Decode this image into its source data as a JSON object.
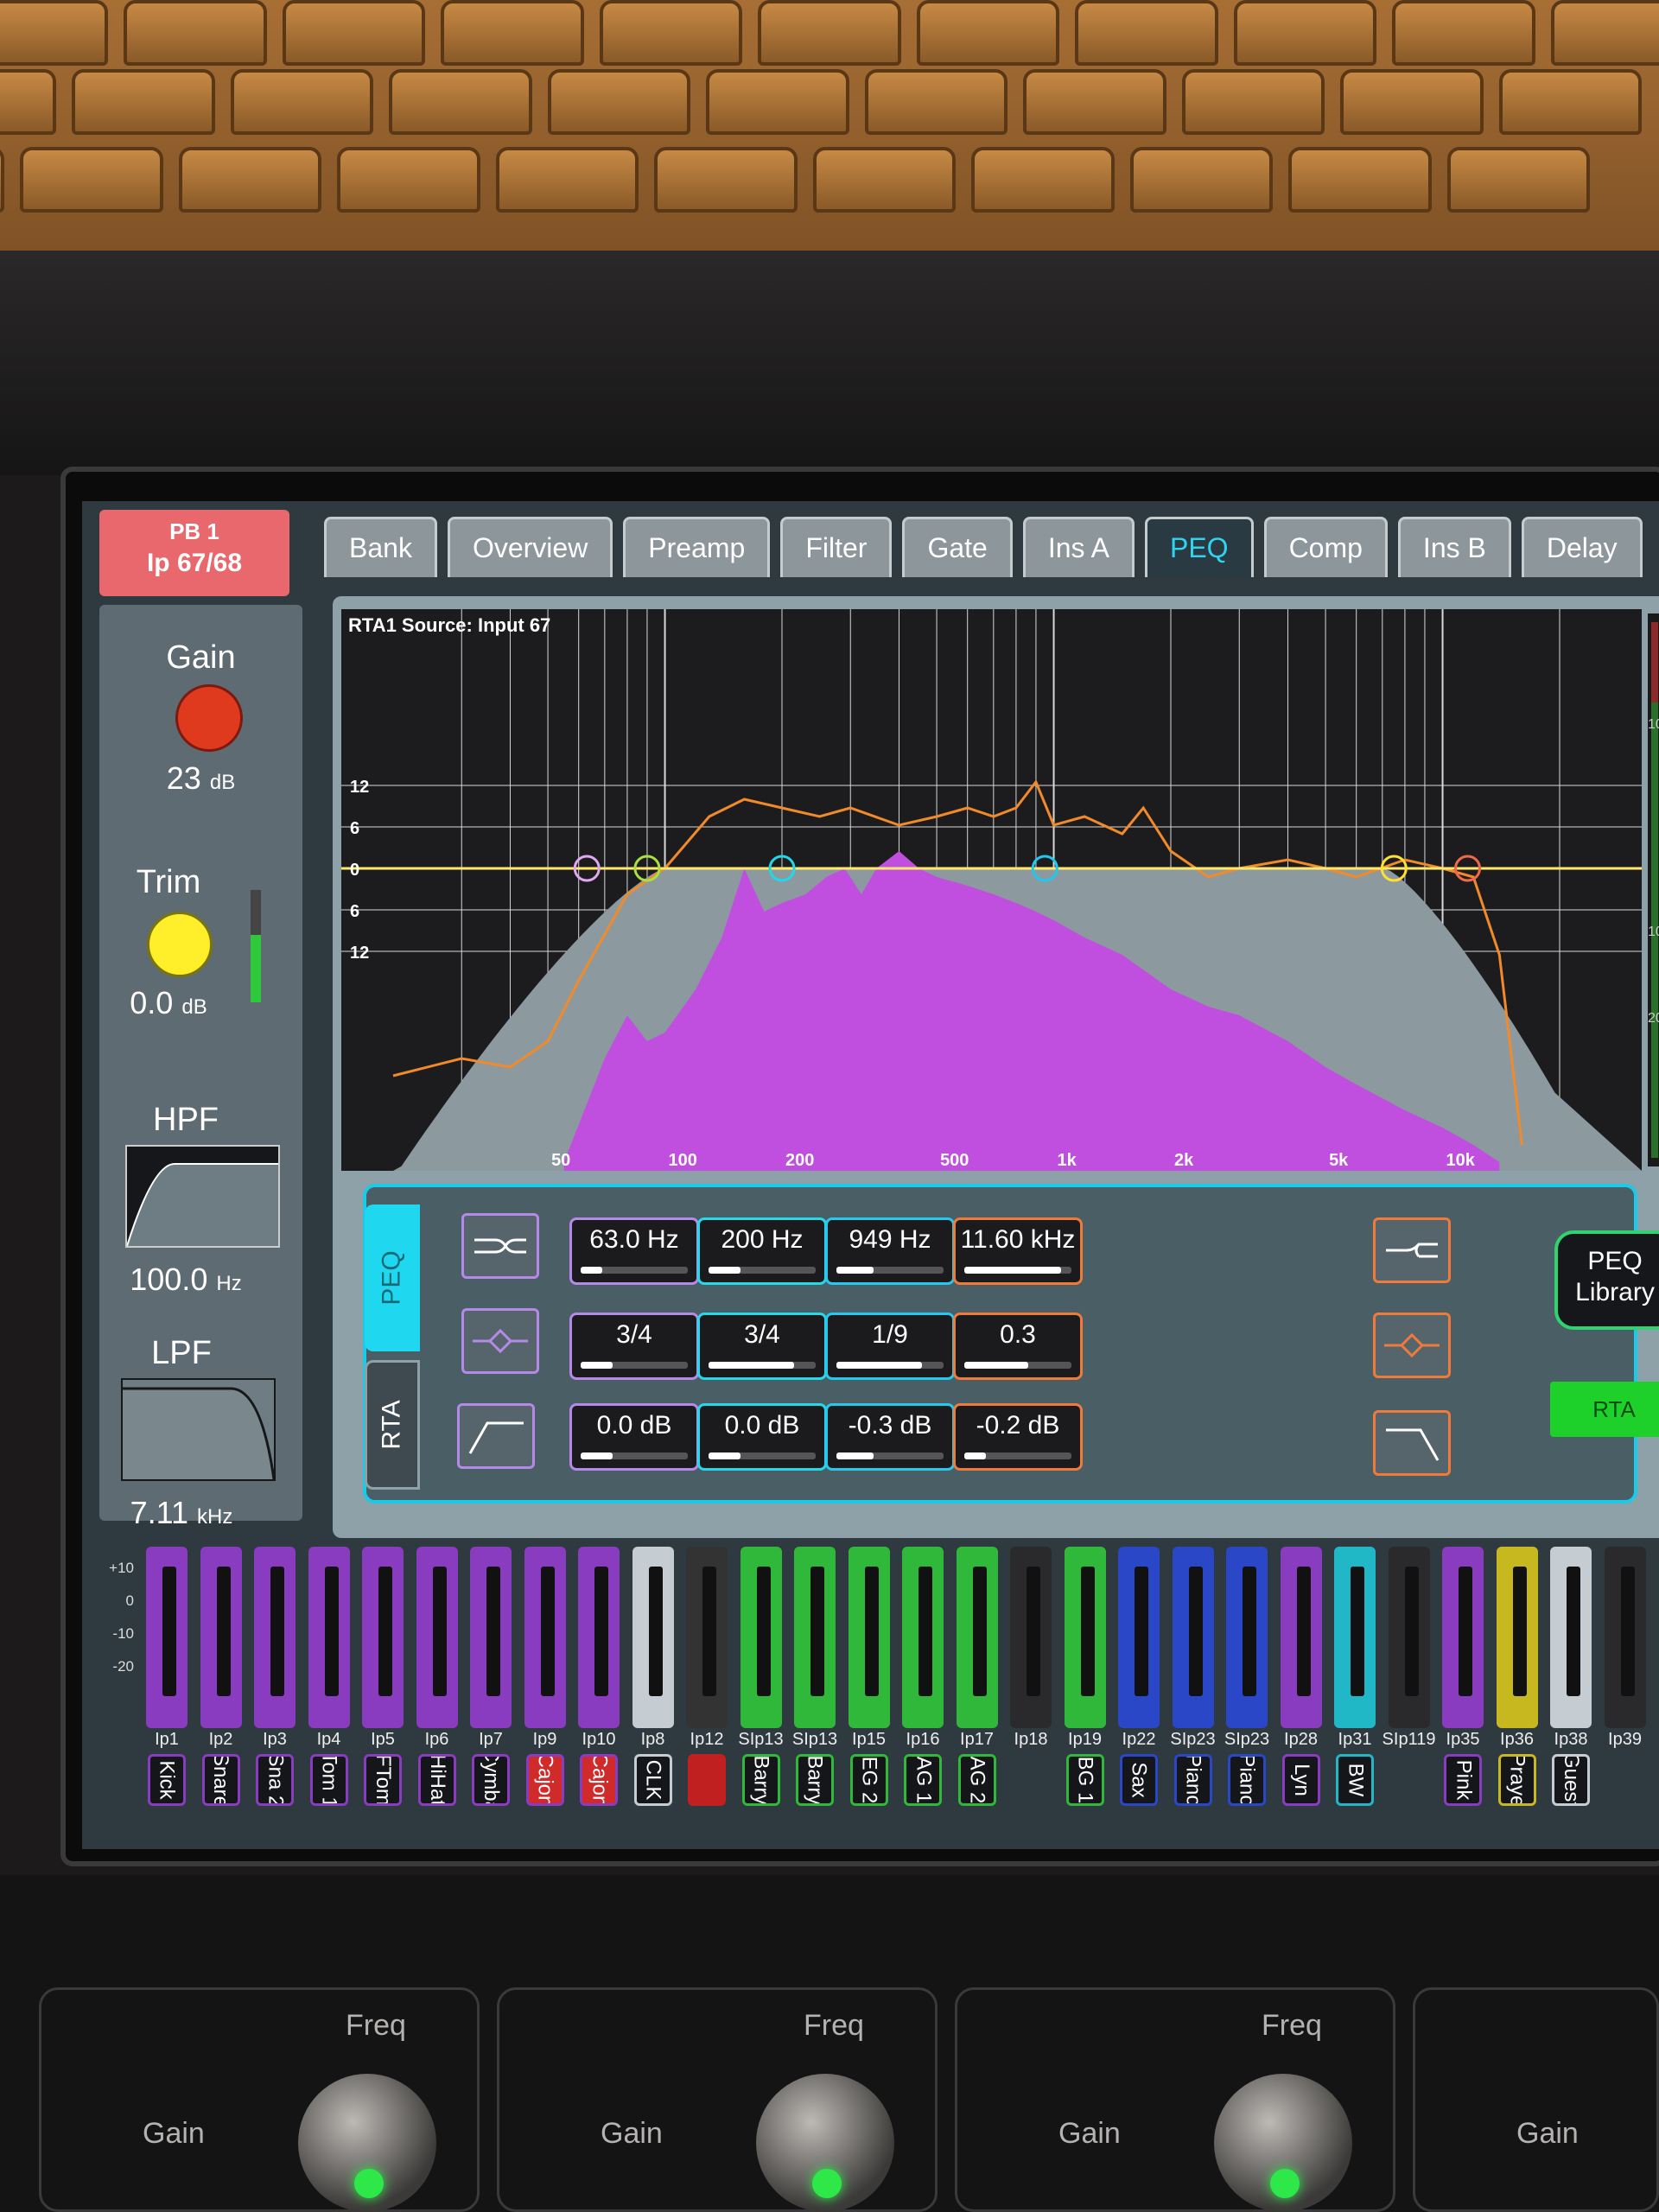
{
  "channel": {
    "bank": "PB 1",
    "input": "Ip 67/68"
  },
  "tabs": [
    "Bank",
    "Overview",
    "Preamp",
    "Filter",
    "Gate",
    "Ins A",
    "PEQ",
    "Comp",
    "Ins B",
    "Delay"
  ],
  "active_tab": "PEQ",
  "left_panel": {
    "gain": {
      "label": "Gain",
      "value": "23",
      "unit": "dB"
    },
    "trim": {
      "label": "Trim",
      "value": "0.0",
      "unit": "dB"
    },
    "hpf": {
      "label": "HPF",
      "value": "100.0",
      "unit": "Hz"
    },
    "lpf": {
      "label": "LPF",
      "value": "7.11",
      "unit": "kHz"
    }
  },
  "graph": {
    "title": "RTA1 Source: Input 67",
    "y_labels": [
      "12",
      "6",
      "0",
      "6",
      "12"
    ],
    "x_labels": [
      "50",
      "100",
      "200",
      "500",
      "1k",
      "2k",
      "5k",
      "10k"
    ],
    "meter_labels": [
      "10",
      "10",
      "20"
    ]
  },
  "peq": {
    "side_tabs": [
      "PEQ",
      "RTA"
    ],
    "bands": [
      {
        "freq": "63.0 Hz",
        "width": "3/4",
        "gain": "0.0 dB",
        "color": "#b589e8"
      },
      {
        "freq": "200 Hz",
        "width": "3/4",
        "gain": "0.0 dB",
        "color": "#26d9e8"
      },
      {
        "freq": "949 Hz",
        "width": "1/9",
        "gain": "-0.3 dB",
        "color": "#26c8f0"
      },
      {
        "freq": "11.60 kHz",
        "width": "0.3",
        "gain": "-0.2 dB",
        "color": "#f07a3a"
      }
    ],
    "library_line1": "PEQ",
    "library_line2": "Library",
    "rta_button": "RTA"
  },
  "strip_scale": [
    "+10",
    "0",
    "-10",
    "-20"
  ],
  "strips": [
    {
      "id": "Ip1",
      "name": "Kick",
      "color": "#8a3cc0"
    },
    {
      "id": "Ip2",
      "name": "Snare",
      "color": "#8a3cc0"
    },
    {
      "id": "Ip3",
      "name": "Sna 2",
      "color": "#8a3cc0"
    },
    {
      "id": "Ip4",
      "name": "Tom 1",
      "color": "#8a3cc0"
    },
    {
      "id": "Ip5",
      "name": "FTom",
      "color": "#8a3cc0"
    },
    {
      "id": "Ip6",
      "name": "HiHat",
      "color": "#8a3cc0"
    },
    {
      "id": "Ip7",
      "name": "Cymba",
      "color": "#8a3cc0"
    },
    {
      "id": "Ip9",
      "name": "Cajon",
      "color": "#8a3cc0"
    },
    {
      "id": "Ip10",
      "name": "Cajon",
      "color": "#8a3cc0"
    },
    {
      "id": "Ip8",
      "name": "CLK",
      "color": "#c6cdd2"
    },
    {
      "id": "Ip12",
      "name": "",
      "color": "#333"
    },
    {
      "id": "SIp13",
      "name": "Barry",
      "color": "#2fb83a"
    },
    {
      "id": "SIp13",
      "name": "Barry",
      "color": "#2fb83a"
    },
    {
      "id": "Ip15",
      "name": "EG 2",
      "color": "#2fb83a"
    },
    {
      "id": "Ip16",
      "name": "AG 1",
      "color": "#2fb83a"
    },
    {
      "id": "Ip17",
      "name": "AG 2",
      "color": "#2fb83a"
    },
    {
      "id": "Ip18",
      "name": "",
      "color": "#2a2a2c"
    },
    {
      "id": "Ip19",
      "name": "BG 1",
      "color": "#2fb83a"
    },
    {
      "id": "Ip22",
      "name": "Sax",
      "color": "#2a47c8"
    },
    {
      "id": "SIp23",
      "name": "Piano",
      "color": "#2a47c8"
    },
    {
      "id": "SIp23",
      "name": "Piano",
      "color": "#2a47c8"
    },
    {
      "id": "Ip28",
      "name": "Lyn",
      "color": "#8a3cc0"
    },
    {
      "id": "Ip31",
      "name": "BW",
      "color": "#20b8c6"
    },
    {
      "id": "SIp119",
      "name": "",
      "color": "#2a2a2c"
    },
    {
      "id": "Ip35",
      "name": "Pink",
      "color": "#8a3cc0"
    },
    {
      "id": "Ip36",
      "name": "Praye",
      "color": "#c8b820"
    },
    {
      "id": "Ip38",
      "name": "Guest",
      "color": "#c6cdd2"
    },
    {
      "id": "Ip39",
      "name": "",
      "color": "#2a2a2c"
    }
  ],
  "hardware": {
    "modules": [
      {
        "freq": "Freq",
        "gain": "Gain"
      },
      {
        "freq": "Freq",
        "gain": "Gain"
      },
      {
        "freq": "Freq",
        "gain": "Gain"
      },
      {
        "gain": "Gain"
      }
    ]
  }
}
